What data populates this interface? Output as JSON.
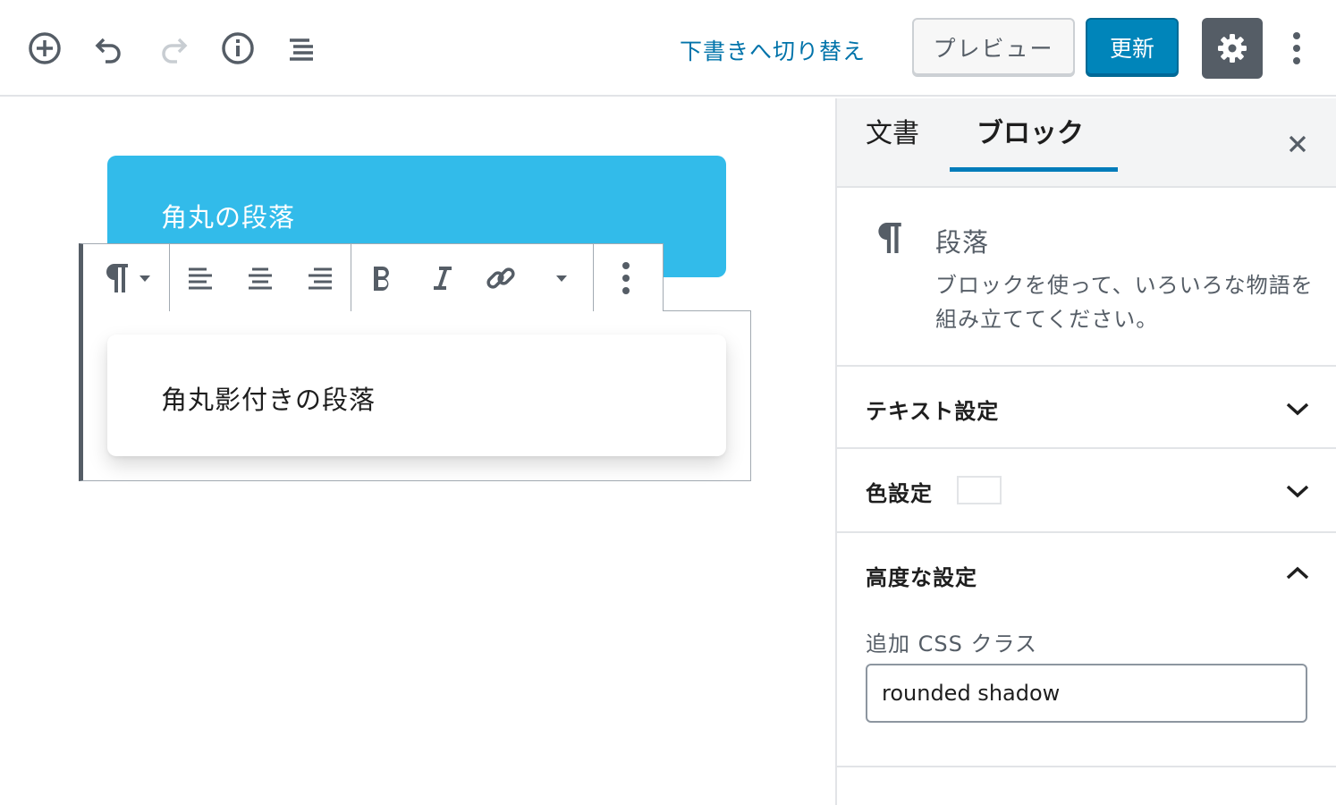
{
  "topbar": {
    "icons": [
      "add-block-icon",
      "undo-icon",
      "redo-icon",
      "info-icon",
      "outline-icon"
    ],
    "switch_to_draft": "下書きへ切り替え",
    "preview_label": "プレビュー",
    "update_label": "更新",
    "settings_icon": "gear-icon",
    "more_icon": "vertical-ellipsis-icon"
  },
  "editor": {
    "block1_text": "角丸の段落",
    "block2_text": "角丸影付きの段落",
    "block1_color": "#32bbea",
    "toolbar_icons": [
      "pilcrow-icon",
      "dropdown-caret-icon",
      "align-left-icon",
      "align-center-icon",
      "align-right-icon",
      "bold-icon",
      "italic-icon",
      "link-icon",
      "more-rich-text-caret-icon",
      "vertical-ellipsis-icon"
    ]
  },
  "sidebar": {
    "tab_document": "文書",
    "tab_block": "ブロック",
    "close_icon": "close-icon",
    "block_name": "段落",
    "block_description": "ブロックを使って、いろいろな物語を組み立ててください。",
    "panel_text": "テキスト設定",
    "panel_color": "色設定",
    "panel_advanced": "高度な設定",
    "css_label": "追加 CSS クラス",
    "css_value": "rounded shadow",
    "accent_color": "#007cba"
  }
}
